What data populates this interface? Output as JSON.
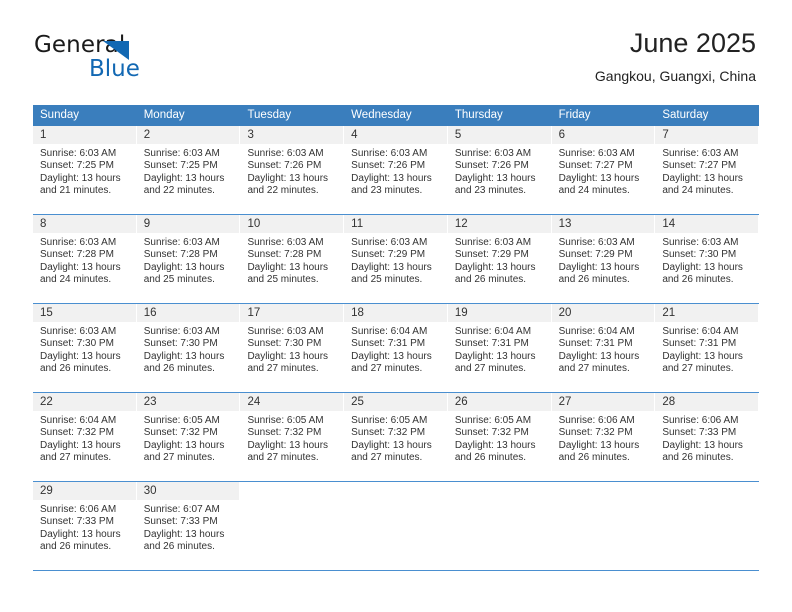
{
  "brand": {
    "name_top": "General",
    "name_bottom": "Blue",
    "triangle_color": "#1268b3",
    "text_color": "#1a1a1a"
  },
  "header": {
    "title": "June 2025",
    "subtitle": "Gangkou, Guangxi, China"
  },
  "colors": {
    "header_blue": "#3a7ebd",
    "row_divider_blue": "#4a8fd0",
    "day_band_gray": "#f1f1f1",
    "text": "#333333"
  },
  "weekdays": [
    "Sunday",
    "Monday",
    "Tuesday",
    "Wednesday",
    "Thursday",
    "Friday",
    "Saturday"
  ],
  "weeks": [
    [
      {
        "day": "1",
        "sunrise": "Sunrise: 6:03 AM",
        "sunset": "Sunset: 7:25 PM",
        "daylight_1": "Daylight: 13 hours",
        "daylight_2": "and 21 minutes."
      },
      {
        "day": "2",
        "sunrise": "Sunrise: 6:03 AM",
        "sunset": "Sunset: 7:25 PM",
        "daylight_1": "Daylight: 13 hours",
        "daylight_2": "and 22 minutes."
      },
      {
        "day": "3",
        "sunrise": "Sunrise: 6:03 AM",
        "sunset": "Sunset: 7:26 PM",
        "daylight_1": "Daylight: 13 hours",
        "daylight_2": "and 22 minutes."
      },
      {
        "day": "4",
        "sunrise": "Sunrise: 6:03 AM",
        "sunset": "Sunset: 7:26 PM",
        "daylight_1": "Daylight: 13 hours",
        "daylight_2": "and 23 minutes."
      },
      {
        "day": "5",
        "sunrise": "Sunrise: 6:03 AM",
        "sunset": "Sunset: 7:26 PM",
        "daylight_1": "Daylight: 13 hours",
        "daylight_2": "and 23 minutes."
      },
      {
        "day": "6",
        "sunrise": "Sunrise: 6:03 AM",
        "sunset": "Sunset: 7:27 PM",
        "daylight_1": "Daylight: 13 hours",
        "daylight_2": "and 24 minutes."
      },
      {
        "day": "7",
        "sunrise": "Sunrise: 6:03 AM",
        "sunset": "Sunset: 7:27 PM",
        "daylight_1": "Daylight: 13 hours",
        "daylight_2": "and 24 minutes."
      }
    ],
    [
      {
        "day": "8",
        "sunrise": "Sunrise: 6:03 AM",
        "sunset": "Sunset: 7:28 PM",
        "daylight_1": "Daylight: 13 hours",
        "daylight_2": "and 24 minutes."
      },
      {
        "day": "9",
        "sunrise": "Sunrise: 6:03 AM",
        "sunset": "Sunset: 7:28 PM",
        "daylight_1": "Daylight: 13 hours",
        "daylight_2": "and 25 minutes."
      },
      {
        "day": "10",
        "sunrise": "Sunrise: 6:03 AM",
        "sunset": "Sunset: 7:28 PM",
        "daylight_1": "Daylight: 13 hours",
        "daylight_2": "and 25 minutes."
      },
      {
        "day": "11",
        "sunrise": "Sunrise: 6:03 AM",
        "sunset": "Sunset: 7:29 PM",
        "daylight_1": "Daylight: 13 hours",
        "daylight_2": "and 25 minutes."
      },
      {
        "day": "12",
        "sunrise": "Sunrise: 6:03 AM",
        "sunset": "Sunset: 7:29 PM",
        "daylight_1": "Daylight: 13 hours",
        "daylight_2": "and 26 minutes."
      },
      {
        "day": "13",
        "sunrise": "Sunrise: 6:03 AM",
        "sunset": "Sunset: 7:29 PM",
        "daylight_1": "Daylight: 13 hours",
        "daylight_2": "and 26 minutes."
      },
      {
        "day": "14",
        "sunrise": "Sunrise: 6:03 AM",
        "sunset": "Sunset: 7:30 PM",
        "daylight_1": "Daylight: 13 hours",
        "daylight_2": "and 26 minutes."
      }
    ],
    [
      {
        "day": "15",
        "sunrise": "Sunrise: 6:03 AM",
        "sunset": "Sunset: 7:30 PM",
        "daylight_1": "Daylight: 13 hours",
        "daylight_2": "and 26 minutes."
      },
      {
        "day": "16",
        "sunrise": "Sunrise: 6:03 AM",
        "sunset": "Sunset: 7:30 PM",
        "daylight_1": "Daylight: 13 hours",
        "daylight_2": "and 26 minutes."
      },
      {
        "day": "17",
        "sunrise": "Sunrise: 6:03 AM",
        "sunset": "Sunset: 7:30 PM",
        "daylight_1": "Daylight: 13 hours",
        "daylight_2": "and 27 minutes."
      },
      {
        "day": "18",
        "sunrise": "Sunrise: 6:04 AM",
        "sunset": "Sunset: 7:31 PM",
        "daylight_1": "Daylight: 13 hours",
        "daylight_2": "and 27 minutes."
      },
      {
        "day": "19",
        "sunrise": "Sunrise: 6:04 AM",
        "sunset": "Sunset: 7:31 PM",
        "daylight_1": "Daylight: 13 hours",
        "daylight_2": "and 27 minutes."
      },
      {
        "day": "20",
        "sunrise": "Sunrise: 6:04 AM",
        "sunset": "Sunset: 7:31 PM",
        "daylight_1": "Daylight: 13 hours",
        "daylight_2": "and 27 minutes."
      },
      {
        "day": "21",
        "sunrise": "Sunrise: 6:04 AM",
        "sunset": "Sunset: 7:31 PM",
        "daylight_1": "Daylight: 13 hours",
        "daylight_2": "and 27 minutes."
      }
    ],
    [
      {
        "day": "22",
        "sunrise": "Sunrise: 6:04 AM",
        "sunset": "Sunset: 7:32 PM",
        "daylight_1": "Daylight: 13 hours",
        "daylight_2": "and 27 minutes."
      },
      {
        "day": "23",
        "sunrise": "Sunrise: 6:05 AM",
        "sunset": "Sunset: 7:32 PM",
        "daylight_1": "Daylight: 13 hours",
        "daylight_2": "and 27 minutes."
      },
      {
        "day": "24",
        "sunrise": "Sunrise: 6:05 AM",
        "sunset": "Sunset: 7:32 PM",
        "daylight_1": "Daylight: 13 hours",
        "daylight_2": "and 27 minutes."
      },
      {
        "day": "25",
        "sunrise": "Sunrise: 6:05 AM",
        "sunset": "Sunset: 7:32 PM",
        "daylight_1": "Daylight: 13 hours",
        "daylight_2": "and 27 minutes."
      },
      {
        "day": "26",
        "sunrise": "Sunrise: 6:05 AM",
        "sunset": "Sunset: 7:32 PM",
        "daylight_1": "Daylight: 13 hours",
        "daylight_2": "and 26 minutes."
      },
      {
        "day": "27",
        "sunrise": "Sunrise: 6:06 AM",
        "sunset": "Sunset: 7:32 PM",
        "daylight_1": "Daylight: 13 hours",
        "daylight_2": "and 26 minutes."
      },
      {
        "day": "28",
        "sunrise": "Sunrise: 6:06 AM",
        "sunset": "Sunset: 7:33 PM",
        "daylight_1": "Daylight: 13 hours",
        "daylight_2": "and 26 minutes."
      }
    ],
    [
      {
        "day": "29",
        "sunrise": "Sunrise: 6:06 AM",
        "sunset": "Sunset: 7:33 PM",
        "daylight_1": "Daylight: 13 hours",
        "daylight_2": "and 26 minutes."
      },
      {
        "day": "30",
        "sunrise": "Sunrise: 6:07 AM",
        "sunset": "Sunset: 7:33 PM",
        "daylight_1": "Daylight: 13 hours",
        "daylight_2": "and 26 minutes."
      },
      {
        "day": "",
        "sunrise": "",
        "sunset": "",
        "daylight_1": "",
        "daylight_2": ""
      },
      {
        "day": "",
        "sunrise": "",
        "sunset": "",
        "daylight_1": "",
        "daylight_2": ""
      },
      {
        "day": "",
        "sunrise": "",
        "sunset": "",
        "daylight_1": "",
        "daylight_2": ""
      },
      {
        "day": "",
        "sunrise": "",
        "sunset": "",
        "daylight_1": "",
        "daylight_2": ""
      },
      {
        "day": "",
        "sunrise": "",
        "sunset": "",
        "daylight_1": "",
        "daylight_2": ""
      }
    ]
  ]
}
